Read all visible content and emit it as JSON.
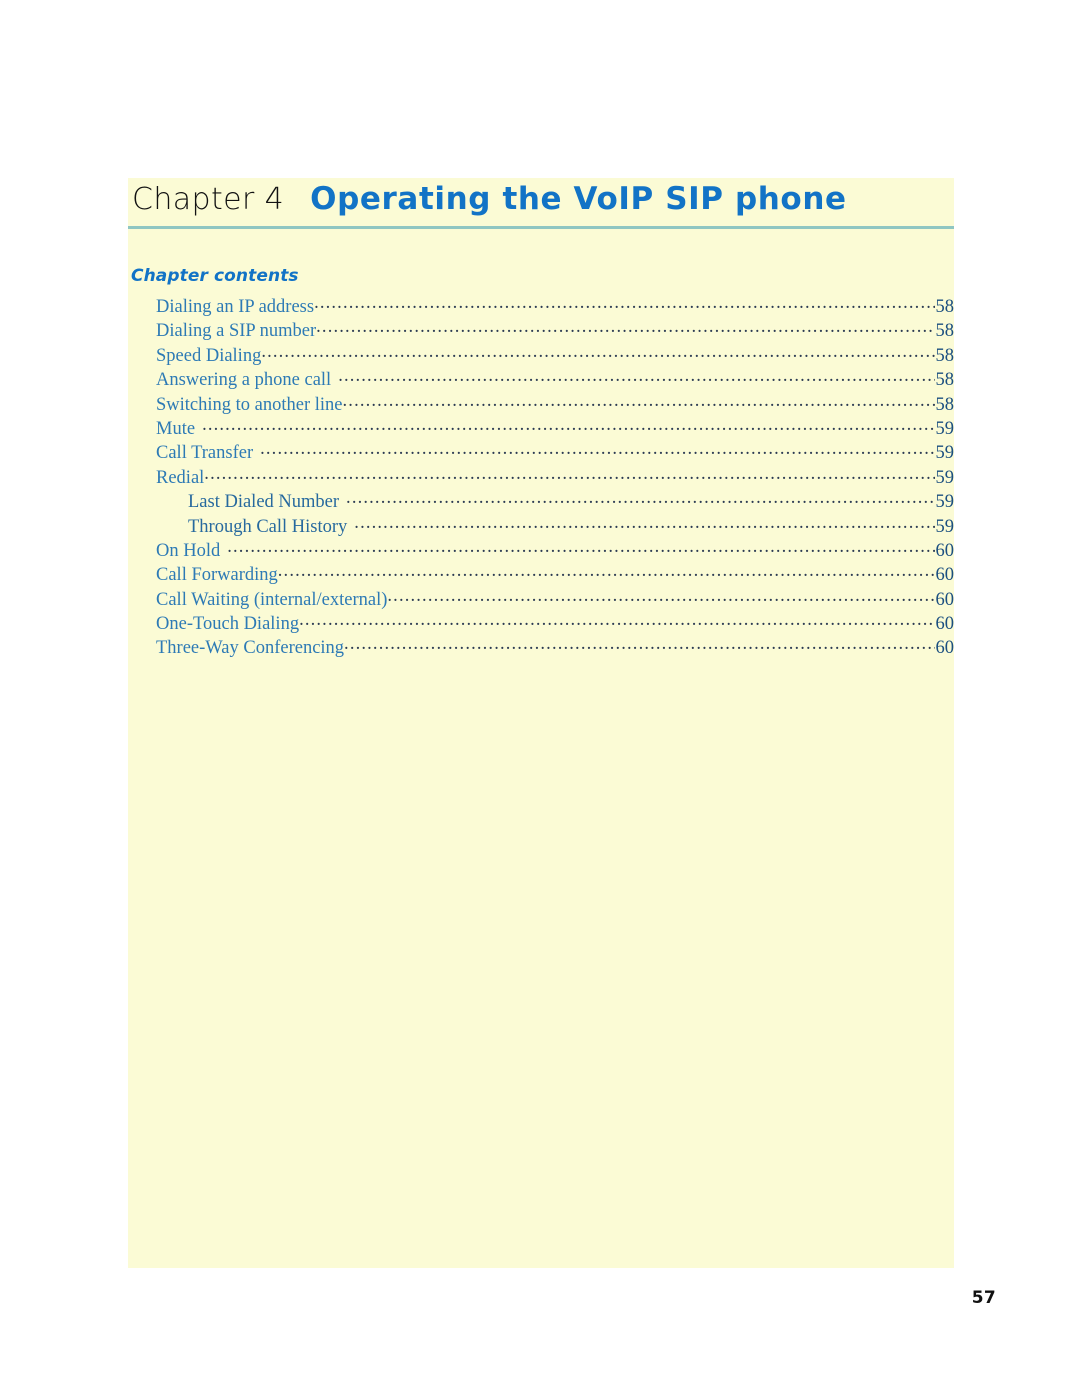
{
  "theme": {
    "panel_background": "#fbfbd5",
    "page_background": "#ffffff",
    "accent_blue": "#1273c6",
    "rule_teal": "#8fc6c2",
    "toc_text_blue": "#2d7ab5",
    "toc_page_blue": "#1b4f80",
    "leader_dot_color": "#2b3a52",
    "chapter_label_color": "#121212"
  },
  "header": {
    "chapter_label": "Chapter 4",
    "chapter_title": "Operating the VoIP SIP phone"
  },
  "contents": {
    "heading": "Chapter contents",
    "entries": [
      {
        "label": "Dialing an IP address",
        "page": "58",
        "indent": false,
        "gap": false
      },
      {
        "label": "Dialing a SIP number",
        "page": "58",
        "indent": false,
        "gap": false
      },
      {
        "label": "Speed Dialing",
        "page": "58",
        "indent": false,
        "gap": false
      },
      {
        "label": "Answering a phone call",
        "page": "58",
        "indent": false,
        "gap": true
      },
      {
        "label": "Switching to another line",
        "page": "58",
        "indent": false,
        "gap": false
      },
      {
        "label": "Mute",
        "page": "59",
        "indent": false,
        "gap": true
      },
      {
        "label": "Call Transfer",
        "page": "59",
        "indent": false,
        "gap": true
      },
      {
        "label": "Redial",
        "page": "59",
        "indent": false,
        "gap": false
      },
      {
        "label": "Last Dialed Number",
        "page": "59",
        "indent": true,
        "gap": true
      },
      {
        "label": "Through Call History",
        "page": "59",
        "indent": true,
        "gap": true
      },
      {
        "label": "On Hold",
        "page": "60",
        "indent": false,
        "gap": true
      },
      {
        "label": "Call Forwarding",
        "page": "60",
        "indent": false,
        "gap": false
      },
      {
        "label": "Call Waiting (internal/external)",
        "page": "60",
        "indent": false,
        "gap": false
      },
      {
        "label": "One-Touch Dialing",
        "page": "60",
        "indent": false,
        "gap": false
      },
      {
        "label": "Three-Way Conferencing",
        "page": "60",
        "indent": false,
        "gap": false
      }
    ]
  },
  "footer": {
    "page_number": "57"
  }
}
